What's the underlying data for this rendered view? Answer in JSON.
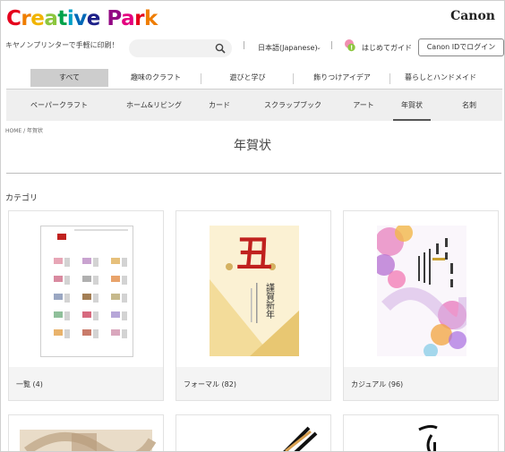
{
  "header": {
    "logo_text": "Creative Park",
    "brand": "Canon",
    "tagline": "キヤノンプリンターで手軽に印刷！",
    "language": "日本語(Japanese)",
    "guide": "はじめてガイド",
    "login": "Canon IDでログイン",
    "separator": "|"
  },
  "main_nav": [
    "すべて",
    "趣味のクラフト",
    "遊びと学び",
    "飾りつけアイデア",
    "暮らしとハンドメイド"
  ],
  "sub_nav": [
    "ペーパークラフト",
    "ホーム&リビング",
    "カード",
    "スクラップブック",
    "アート",
    "年賀状",
    "名刺"
  ],
  "breadcrumb": "HOME / 年賀状",
  "page_title": "年賀状",
  "category_heading": "カテゴリ",
  "cards": [
    {
      "label": "一覧 (4)"
    },
    {
      "label": "フォーマル (82)"
    },
    {
      "label": "カジュアル (96)"
    }
  ],
  "thumb_texts": {
    "formal_big": "丑",
    "formal_vert": "謹賀新年"
  },
  "colors": {
    "accent_gray": "#cdcdcd",
    "subnav_bg": "#efefef",
    "card_bg": "#f4f4f4",
    "seal_red": "#c0211e"
  }
}
